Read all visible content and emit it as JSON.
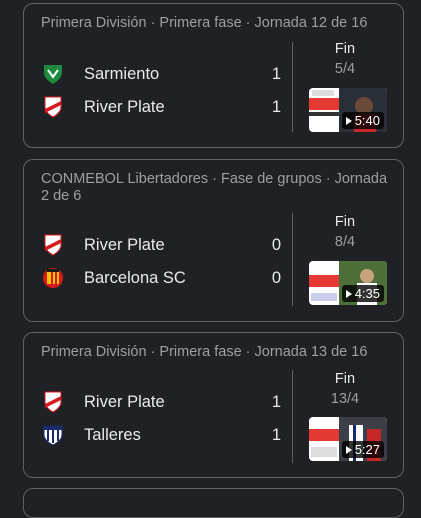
{
  "matches": [
    {
      "header": "Primera División · Primera fase · Jornada 12 de 16",
      "teams": [
        {
          "name": "Sarmiento",
          "score": "1",
          "crest": "sarmiento-crest-icon"
        },
        {
          "name": "River Plate",
          "score": "1",
          "crest": "river-plate-crest-icon"
        }
      ],
      "status": "Fin",
      "date": "5/4",
      "duration": "5:40"
    },
    {
      "header": "CONMEBOL Libertadores · Fase de grupos · Jornada 2 de 6",
      "teams": [
        {
          "name": "River Plate",
          "score": "0",
          "crest": "river-plate-crest-icon"
        },
        {
          "name": "Barcelona SC",
          "score": "0",
          "crest": "barcelona-sc-crest-icon"
        }
      ],
      "status": "Fin",
      "date": "8/4",
      "duration": "4:35"
    },
    {
      "header": "Primera División · Primera fase · Jornada 13 de 16",
      "teams": [
        {
          "name": "River Plate",
          "score": "1",
          "crest": "river-plate-crest-icon"
        },
        {
          "name": "Talleres",
          "score": "1",
          "crest": "talleres-crest-icon"
        }
      ],
      "status": "Fin",
      "date": "13/4",
      "duration": "5:27"
    }
  ],
  "colors": {
    "background": "#202124",
    "border": "#5f6368",
    "muted_text": "#9aa0a6",
    "text": "#e8eaed",
    "river_red": "#d7191f",
    "sarmiento_green": "#1d8a3e",
    "barcelona_yellow": "#f5c400",
    "talleres_blue": "#1b2b6b"
  }
}
